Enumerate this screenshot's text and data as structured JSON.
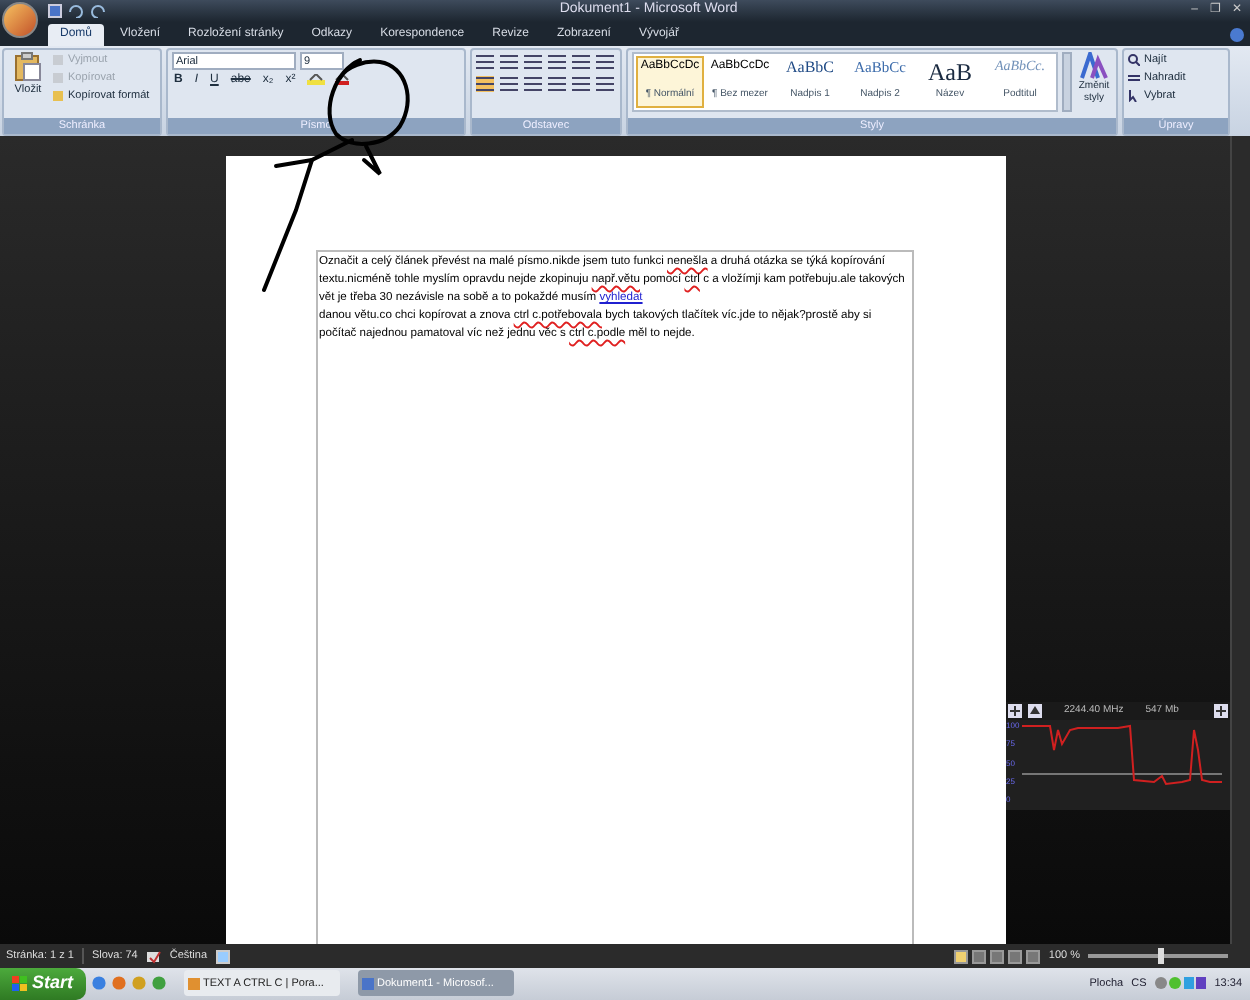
{
  "window": {
    "title": "Dokument1 - Microsoft Word",
    "controls": [
      "–",
      "❐",
      "✕"
    ]
  },
  "tabs": [
    {
      "label": "Domů",
      "selected": true
    },
    {
      "label": "Vložení",
      "selected": false
    },
    {
      "label": "Rozložení stránky",
      "selected": false
    },
    {
      "label": "Odkazy",
      "selected": false
    },
    {
      "label": "Korespondence",
      "selected": false
    },
    {
      "label": "Revize",
      "selected": false
    },
    {
      "label": "Zobrazení",
      "selected": false
    },
    {
      "label": "Vývojář",
      "selected": false
    }
  ],
  "clipboard": {
    "label": "Schránka",
    "paste": "Vložit",
    "items": [
      {
        "label": "Vyjmout",
        "disabled": true
      },
      {
        "label": "Kopírovat",
        "disabled": true
      },
      {
        "label": "Kopírovat formát",
        "disabled": false
      }
    ]
  },
  "font": {
    "label": "Písmo",
    "family": "Arial",
    "size": "9",
    "buttons": [
      "B",
      "I",
      "U",
      "abe",
      "x₂",
      "x²"
    ]
  },
  "paragraph": {
    "label": "Odstavec"
  },
  "styles": {
    "label": "Styly",
    "items": [
      {
        "sample": "AaBbCcDc",
        "name": "¶ Normální",
        "selected": true
      },
      {
        "sample": "AaBbCcDc",
        "name": "¶ Bez mezer",
        "selected": false
      },
      {
        "sample": "AaBbC",
        "name": "Nadpis 1",
        "selected": false
      },
      {
        "sample": "AaBbCc",
        "name": "Nadpis 2",
        "selected": false
      },
      {
        "sample": "AaB",
        "name": "Název",
        "selected": false
      },
      {
        "sample": "AaBbCc.",
        "name": "Podtitul",
        "selected": false
      }
    ],
    "change": "Změnit styly"
  },
  "editing": {
    "label": "Úpravy",
    "items": [
      "Najít",
      "Nahradit",
      "Vybrat"
    ]
  },
  "document": {
    "paragraphs": [
      [
        {
          "kind": "text",
          "text": "Označit a celý článek převést na malé písmo.nikde jsem tuto funkci "
        },
        {
          "kind": "misspelled",
          "text": "nenešla"
        },
        {
          "kind": "text",
          "text": " a druhá otázka se týká kopírování textu.nicméně tohle myslím opravdu nejde zkopinuju "
        },
        {
          "kind": "misspelled",
          "text": "např.větu"
        },
        {
          "kind": "text",
          "text": " pomocí "
        },
        {
          "kind": "misspelled",
          "text": "ctrl"
        },
        {
          "kind": "text",
          "text": " c a vložímji kam potřebuju.ale takových vět je třeba 30 nezávisle na sobě a to pokaždé musím "
        },
        {
          "kind": "link",
          "text": "vyhledat"
        }
      ],
      [
        {
          "kind": "text",
          "text": " danou větu.co chci kopírovat a znova "
        },
        {
          "kind": "misspelled",
          "text": "ctrl c.potřebovala"
        },
        {
          "kind": "text",
          "text": " bych takových tlačítek víc.jde to nějak?prostě aby si počítač najednou pamatoval víc než jednu věc s "
        },
        {
          "kind": "misspelled",
          "text": "ctrl c.podle"
        },
        {
          "kind": "text",
          "text": " měl to  nejde."
        }
      ]
    ]
  },
  "status_bar": {
    "page": "Stránka: 1 z 1",
    "words": "Slova: 74",
    "language": "Čeština",
    "zoom": "100 %",
    "zoom_slider": {
      "level": 0.5
    }
  },
  "gadget": {
    "cpu": "2244.40 MHz",
    "memory": "547 Mb",
    "axis": [
      "100",
      "75",
      "50",
      "25",
      "0"
    ]
  },
  "taskbar": {
    "start": "Start",
    "tasks": [
      {
        "label": "TEXT A CTRL C | Pora...",
        "selected": false
      },
      {
        "label": "Dokument1 - Microsof...",
        "selected": true
      }
    ],
    "tray": {
      "desktop": "Plocha",
      "language": "CS",
      "clock": "13:34"
    }
  }
}
